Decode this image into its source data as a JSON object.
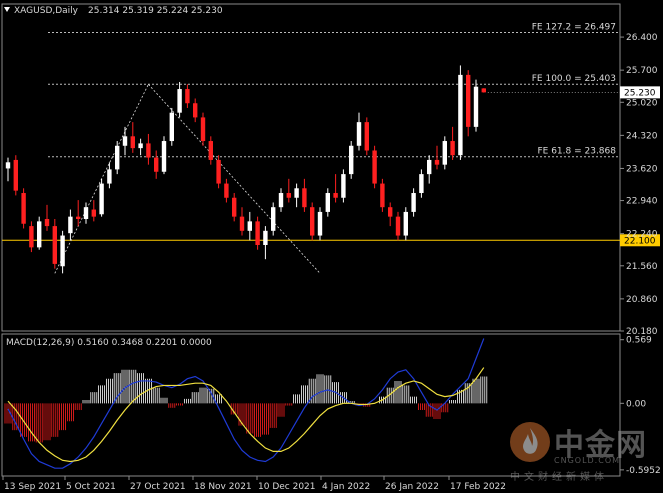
{
  "header": {
    "symbol": "XAGUSD,Daily",
    "ohlc": "25.314 25.319 25.224 25.230",
    "indicator": "MACD(12,26,9) 0.5160 0.3468 0.2201 0.0000"
  },
  "colors": {
    "background": "#000000",
    "bull_candle": "#ffffff",
    "bear_candle": "#ff2020",
    "support_line": "#ffcc00",
    "fe_lines": "#bbbbbb",
    "macd_line": "#1f3bd6",
    "signal_line": "#f0e040",
    "hist_pos": "#ffffff",
    "hist_neg": "#ff2020"
  },
  "watermark": {
    "brand": "中金网",
    "url": "CNGOLD.COM",
    "tagline": "中文财经新媒体",
    "logo": "flame-logo-icon"
  },
  "chart_data": [
    {
      "type": "candlestick",
      "title": "XAGUSD,Daily",
      "ylim": [
        20.18,
        27.1
      ],
      "yticks": [
        "26.400",
        "25.700",
        "25.020",
        "24.320",
        "23.620",
        "22.940",
        "22.240",
        "21.560",
        "20.860",
        "20.180"
      ],
      "xticks": [
        "13 Sep 2021",
        "5 Oct 2021",
        "27 Oct 2021",
        "18 Nov 2021",
        "10 Dec 2021",
        "4 Jan 2022",
        "26 Jan 2022",
        "17 Feb 2022"
      ],
      "current_price": "25.230",
      "horizontal_levels": [
        {
          "label": "FE 127.2 = 26.497",
          "value": 26.497
        },
        {
          "label": "FE 100.0 = 25.403",
          "value": 25.403
        },
        {
          "label": "FE 61.8 = 23.868",
          "value": 23.868
        },
        {
          "label": "22.100",
          "value": 22.1,
          "kind": "support"
        }
      ],
      "fib_anchors": [
        {
          "x": 0,
          "y": 21.4
        },
        {
          "x": 12,
          "y": 25.4
        },
        {
          "x": 22,
          "y": 21.4
        }
      ],
      "series": [
        {
          "o": 23.62,
          "h": 23.85,
          "l": 23.35,
          "c": 23.75
        },
        {
          "o": 23.8,
          "h": 23.9,
          "l": 23.05,
          "c": 23.15
        },
        {
          "o": 23.1,
          "h": 23.2,
          "l": 22.35,
          "c": 22.45
        },
        {
          "o": 22.4,
          "h": 22.5,
          "l": 21.85,
          "c": 21.95
        },
        {
          "o": 21.95,
          "h": 22.6,
          "l": 21.9,
          "c": 22.5
        },
        {
          "o": 22.55,
          "h": 22.85,
          "l": 22.3,
          "c": 22.4
        },
        {
          "o": 22.4,
          "h": 22.55,
          "l": 21.5,
          "c": 21.6
        },
        {
          "o": 21.55,
          "h": 22.3,
          "l": 21.4,
          "c": 22.2
        },
        {
          "o": 22.25,
          "h": 22.75,
          "l": 22.1,
          "c": 22.6
        },
        {
          "o": 22.6,
          "h": 22.95,
          "l": 22.4,
          "c": 22.55
        },
        {
          "o": 22.55,
          "h": 22.9,
          "l": 22.45,
          "c": 22.8
        },
        {
          "o": 22.75,
          "h": 22.95,
          "l": 22.5,
          "c": 22.6
        },
        {
          "o": 22.65,
          "h": 23.4,
          "l": 22.6,
          "c": 23.3
        },
        {
          "o": 23.3,
          "h": 23.75,
          "l": 23.2,
          "c": 23.6
        },
        {
          "o": 23.6,
          "h": 24.2,
          "l": 23.5,
          "c": 24.1
        },
        {
          "o": 24.1,
          "h": 24.5,
          "l": 23.9,
          "c": 24.3
        },
        {
          "o": 24.3,
          "h": 24.6,
          "l": 23.95,
          "c": 24.05
        },
        {
          "o": 24.05,
          "h": 24.25,
          "l": 23.9,
          "c": 24.15
        },
        {
          "o": 24.15,
          "h": 24.35,
          "l": 23.7,
          "c": 23.85
        },
        {
          "o": 23.85,
          "h": 24.0,
          "l": 23.4,
          "c": 23.55
        },
        {
          "o": 23.55,
          "h": 24.3,
          "l": 23.5,
          "c": 24.2
        },
        {
          "o": 24.2,
          "h": 24.9,
          "l": 24.1,
          "c": 24.8
        },
        {
          "o": 24.8,
          "h": 25.45,
          "l": 24.7,
          "c": 25.3
        },
        {
          "o": 25.3,
          "h": 25.4,
          "l": 24.9,
          "c": 25.0
        },
        {
          "o": 25.0,
          "h": 25.1,
          "l": 24.6,
          "c": 24.7
        },
        {
          "o": 24.7,
          "h": 24.8,
          "l": 24.1,
          "c": 24.2
        },
        {
          "o": 24.2,
          "h": 24.3,
          "l": 23.7,
          "c": 23.8
        },
        {
          "o": 23.8,
          "h": 23.9,
          "l": 23.2,
          "c": 23.3
        },
        {
          "o": 23.3,
          "h": 23.4,
          "l": 22.9,
          "c": 23.0
        },
        {
          "o": 23.0,
          "h": 23.1,
          "l": 22.5,
          "c": 22.6
        },
        {
          "o": 22.6,
          "h": 22.8,
          "l": 22.2,
          "c": 22.3
        },
        {
          "o": 22.3,
          "h": 22.7,
          "l": 22.1,
          "c": 22.5
        },
        {
          "o": 22.5,
          "h": 22.6,
          "l": 21.9,
          "c": 22.0
        },
        {
          "o": 22.0,
          "h": 22.4,
          "l": 21.7,
          "c": 22.3
        },
        {
          "o": 22.3,
          "h": 22.9,
          "l": 22.2,
          "c": 22.8
        },
        {
          "o": 22.8,
          "h": 23.2,
          "l": 22.7,
          "c": 23.1
        },
        {
          "o": 23.1,
          "h": 23.4,
          "l": 22.9,
          "c": 23.0
        },
        {
          "o": 23.0,
          "h": 23.3,
          "l": 22.8,
          "c": 23.2
        },
        {
          "o": 23.2,
          "h": 23.4,
          "l": 22.7,
          "c": 22.8
        },
        {
          "o": 22.8,
          "h": 22.9,
          "l": 22.1,
          "c": 22.2
        },
        {
          "o": 22.2,
          "h": 22.8,
          "l": 22.1,
          "c": 22.7
        },
        {
          "o": 22.7,
          "h": 23.2,
          "l": 22.6,
          "c": 23.1
        },
        {
          "o": 23.1,
          "h": 23.5,
          "l": 22.9,
          "c": 23.0
        },
        {
          "o": 23.0,
          "h": 23.6,
          "l": 22.9,
          "c": 23.5
        },
        {
          "o": 23.5,
          "h": 24.2,
          "l": 23.4,
          "c": 24.1
        },
        {
          "o": 24.1,
          "h": 24.8,
          "l": 24.0,
          "c": 24.6
        },
        {
          "o": 24.6,
          "h": 24.7,
          "l": 23.9,
          "c": 24.0
        },
        {
          "o": 24.0,
          "h": 24.1,
          "l": 23.2,
          "c": 23.3
        },
        {
          "o": 23.3,
          "h": 23.4,
          "l": 22.7,
          "c": 22.8
        },
        {
          "o": 22.8,
          "h": 22.9,
          "l": 22.4,
          "c": 22.6
        },
        {
          "o": 22.6,
          "h": 22.7,
          "l": 22.1,
          "c": 22.2
        },
        {
          "o": 22.2,
          "h": 22.8,
          "l": 22.1,
          "c": 22.7
        },
        {
          "o": 22.7,
          "h": 23.2,
          "l": 22.6,
          "c": 23.1
        },
        {
          "o": 23.1,
          "h": 23.6,
          "l": 23.0,
          "c": 23.5
        },
        {
          "o": 23.5,
          "h": 23.9,
          "l": 23.3,
          "c": 23.8
        },
        {
          "o": 23.8,
          "h": 24.1,
          "l": 23.6,
          "c": 23.7
        },
        {
          "o": 23.7,
          "h": 24.3,
          "l": 23.6,
          "c": 24.2
        },
        {
          "o": 24.2,
          "h": 24.5,
          "l": 23.8,
          "c": 23.9
        },
        {
          "o": 23.9,
          "h": 25.8,
          "l": 23.8,
          "c": 25.6
        },
        {
          "o": 25.6,
          "h": 25.7,
          "l": 24.3,
          "c": 24.5
        },
        {
          "o": 24.5,
          "h": 25.5,
          "l": 24.4,
          "c": 25.35
        },
        {
          "o": 25.314,
          "h": 25.319,
          "l": 25.224,
          "c": 25.23
        }
      ]
    },
    {
      "type": "macd",
      "title": "MACD(12,26,9)",
      "ylim": [
        -0.65,
        0.62
      ],
      "yticks": [
        "0.569",
        "0.00",
        "-0.5952"
      ],
      "histogram": [
        -0.18,
        -0.24,
        -0.3,
        -0.34,
        -0.35,
        -0.33,
        -0.3,
        -0.24,
        -0.16,
        -0.06,
        0.03,
        0.1,
        0.16,
        0.22,
        0.27,
        0.3,
        0.3,
        0.27,
        0.22,
        0.14,
        0.05,
        -0.04,
        -0.02,
        0.04,
        0.1,
        0.14,
        0.13,
        0.08,
        0.0,
        -0.1,
        -0.2,
        -0.27,
        -0.3,
        -0.28,
        -0.22,
        -0.12,
        -0.02,
        0.08,
        0.16,
        0.22,
        0.26,
        0.25,
        0.19,
        0.1,
        0.02,
        -0.02,
        -0.03,
        0.0,
        0.06,
        0.14,
        0.2,
        0.16,
        0.06,
        -0.06,
        -0.12,
        -0.14,
        -0.08,
        0.03,
        0.12,
        0.18,
        0.22,
        0.24
      ],
      "macd": [
        -0.05,
        -0.18,
        -0.32,
        -0.45,
        -0.52,
        -0.55,
        -0.58,
        -0.58,
        -0.54,
        -0.48,
        -0.4,
        -0.3,
        -0.18,
        -0.06,
        0.06,
        0.14,
        0.18,
        0.2,
        0.2,
        0.19,
        0.16,
        0.14,
        0.17,
        0.22,
        0.24,
        0.2,
        0.1,
        -0.04,
        -0.18,
        -0.32,
        -0.42,
        -0.48,
        -0.51,
        -0.52,
        -0.48,
        -0.4,
        -0.28,
        -0.16,
        -0.04,
        0.06,
        0.1,
        0.12,
        0.1,
        0.05,
        0.0,
        -0.02,
        -0.01,
        0.04,
        0.12,
        0.22,
        0.28,
        0.3,
        0.22,
        0.1,
        -0.02,
        -0.06,
        0.0,
        0.08,
        0.15,
        0.22,
        0.4,
        0.58
      ],
      "signal": [
        0.02,
        -0.06,
        -0.16,
        -0.26,
        -0.35,
        -0.42,
        -0.47,
        -0.51,
        -0.52,
        -0.51,
        -0.48,
        -0.42,
        -0.34,
        -0.25,
        -0.15,
        -0.06,
        0.02,
        0.08,
        0.12,
        0.15,
        0.16,
        0.16,
        0.16,
        0.17,
        0.18,
        0.18,
        0.16,
        0.1,
        0.02,
        -0.08,
        -0.18,
        -0.27,
        -0.34,
        -0.4,
        -0.43,
        -0.43,
        -0.4,
        -0.34,
        -0.27,
        -0.19,
        -0.11,
        -0.05,
        -0.02,
        0.0,
        0.0,
        -0.01,
        -0.01,
        0.0,
        0.03,
        0.08,
        0.14,
        0.18,
        0.2,
        0.18,
        0.13,
        0.08,
        0.06,
        0.07,
        0.1,
        0.14,
        0.22,
        0.32
      ]
    }
  ]
}
